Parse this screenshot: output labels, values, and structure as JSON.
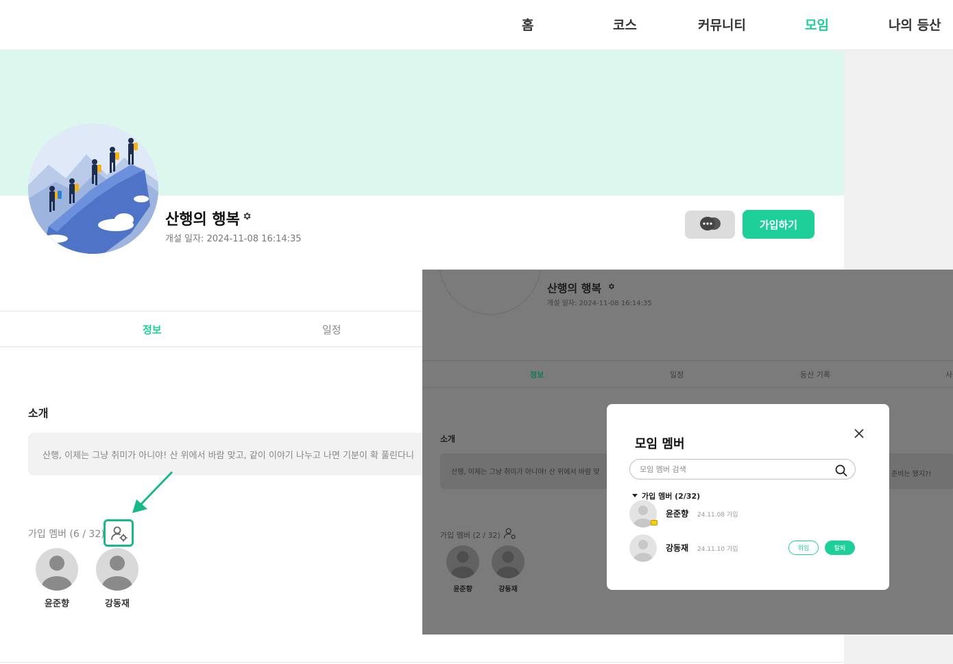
{
  "nav": {
    "items": [
      {
        "label": "홈"
      },
      {
        "label": "코스"
      },
      {
        "label": "커뮤니티"
      },
      {
        "label": "모임",
        "active": true
      },
      {
        "label": "나의 등산"
      }
    ],
    "active_color": "#1fcf9a"
  },
  "group": {
    "title": "산행의 행복",
    "created": "개설 일자: 2024-11-08 16:14:35",
    "join_label": "가입하기",
    "banner_color": "#dcf7ee"
  },
  "tabs": [
    {
      "label": "정보",
      "active": true
    },
    {
      "label": "일정"
    }
  ],
  "intro": {
    "heading": "소개",
    "text": "산행, 이제는 그냥 취미가 아니야! 산 위에서 바람 맞고, 같이 이야기 나누고 나면 기분이 확 풀린다니"
  },
  "members": {
    "label": "가입 멤버 (6 / 32)",
    "list": [
      {
        "name": "윤준향"
      },
      {
        "name": "강동재"
      }
    ]
  },
  "overlay": {
    "title": "산행의 행복",
    "created": "개설 일자: 2024-11-08 16:14:35",
    "tabs": [
      {
        "label": "정보",
        "active": true
      },
      {
        "label": "일정"
      },
      {
        "label": "등산 기록"
      },
      {
        "label": "사"
      }
    ],
    "intro_heading": "소개",
    "intro_text": "산행, 이제는 그냥 취미가 아니야! 산 위에서 바람 맞",
    "intro_tail": "준비는 됐지?!",
    "members_label": "가입 멤버 (2 / 32)",
    "members": [
      {
        "name": "윤준향"
      },
      {
        "name": "강동재"
      }
    ]
  },
  "modal": {
    "title": "모임 멤버",
    "search_placeholder": "모임 멤버 검색",
    "section_label": "가입 멤버 (2/32)",
    "members": [
      {
        "name": "윤준향",
        "date": "24.11.08 가입",
        "leader": true
      },
      {
        "name": "강동재",
        "date": "24.11.10 가입",
        "delegate_label": "위임",
        "kick_label": "탈퇴"
      }
    ]
  },
  "icons": [
    "gear-icon",
    "chat-icon",
    "member-settings-icon",
    "arrow-icon",
    "close-icon",
    "search-icon",
    "crown-icon",
    "avatar-icon"
  ]
}
